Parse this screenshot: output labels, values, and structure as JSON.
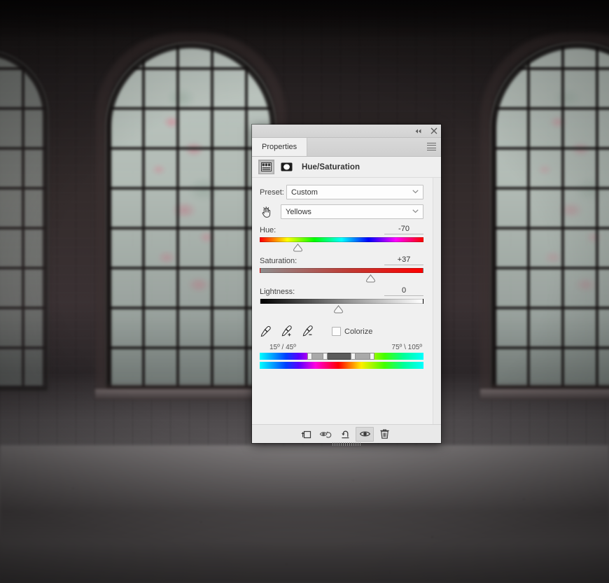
{
  "window": {
    "titlebar": {
      "collapse_icon": "double-chevron-left-icon",
      "close_icon": "close-icon"
    },
    "tabs": [
      {
        "label": "Properties",
        "active": true
      }
    ],
    "panel_menu_icon": "hamburger-menu-icon"
  },
  "header": {
    "adjustment_icon": "adjustment-layer-icon",
    "mask_icon": "layer-mask-icon",
    "title": "Hue/Saturation"
  },
  "controls": {
    "preset_label": "Preset:",
    "preset_value": "Custom",
    "on_image_tool_icon": "on-image-adjustment-hand-icon",
    "channel_value": "Yellows",
    "dropdown_icon": "chevron-down-icon"
  },
  "sliders": [
    {
      "name": "hue",
      "label": "Hue:",
      "value": "-70",
      "thumb_percent": 23,
      "track": "hue-spectrum"
    },
    {
      "name": "saturation",
      "label": "Saturation:",
      "value": "+37",
      "thumb_percent": 68,
      "track": "saturation-gradient"
    },
    {
      "name": "lightness",
      "label": "Lightness:",
      "value": "0",
      "thumb_percent": 48,
      "track": "lightness-gradient"
    }
  ],
  "tools": {
    "eyedropper_icon": "eyedropper-icon",
    "eyedropper_add_icon": "eyedropper-plus-icon",
    "eyedropper_subtract_icon": "eyedropper-minus-icon",
    "colorize_label": "Colorize",
    "colorize_checked": false
  },
  "range": {
    "left_degrees": "15º / 45º",
    "right_degrees": "75º \\ 105º",
    "core_start_percent": 40.0,
    "core_end_percent": 57.0,
    "falloff_start_percent": 30.5,
    "falloff_end_percent": 68.5
  },
  "footer": {
    "buttons": [
      {
        "name": "clip-to-layer-button",
        "icon": "clip-to-layer-icon",
        "active": false
      },
      {
        "name": "view-previous-state-button",
        "icon": "eye-previous-state-icon",
        "active": false
      },
      {
        "name": "reset-button",
        "icon": "reset-arrow-icon",
        "active": false
      },
      {
        "name": "toggle-layer-visibility-button",
        "icon": "eye-icon",
        "active": true
      },
      {
        "name": "delete-adjustment-button",
        "icon": "trash-icon",
        "active": false
      }
    ],
    "resize_grip_icon": "resize-grip-icon"
  }
}
